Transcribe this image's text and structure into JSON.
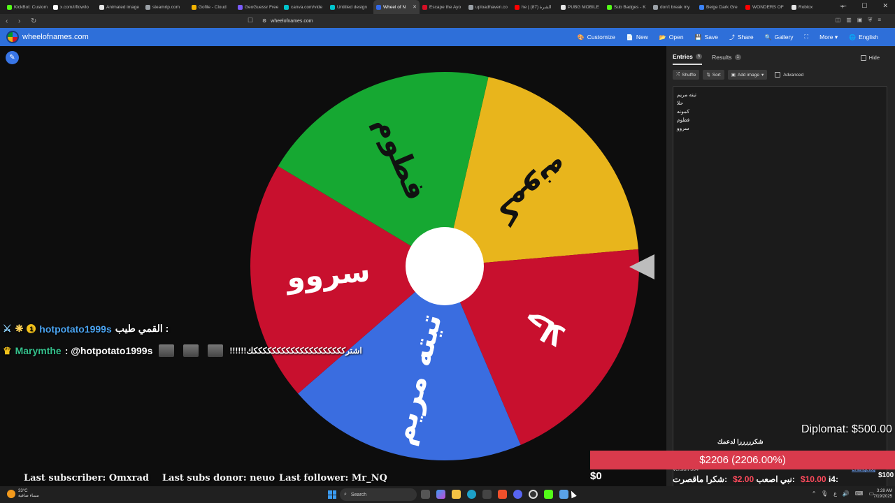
{
  "browser": {
    "tabs": [
      {
        "label": "KickBot: Custom",
        "color": "#53fc18"
      },
      {
        "label": "x.com/i/flow/lo",
        "color": "#ffffff"
      },
      {
        "label": "Animated image",
        "color": "#e5e5e5"
      },
      {
        "label": "steamrip.com",
        "color": "#9aa0a6"
      },
      {
        "label": "Gofile - Cloud",
        "color": "#f4b400"
      },
      {
        "label": "GeoGuessr Free",
        "color": "#7b5cff"
      },
      {
        "label": "canva.com/vide",
        "color": "#00c4cc"
      },
      {
        "label": "Untitled design",
        "color": "#00c4cc"
      },
      {
        "label": "Wheel of N",
        "color": "#3369e8",
        "active": true
      },
      {
        "label": "Escape the Ayo",
        "color": "#d50f25"
      },
      {
        "label": "uploadhaven.co",
        "color": "#9aa0a6"
      },
      {
        "label": "he | الشرة (87)",
        "color": "#ff0000"
      },
      {
        "label": "PUBG MOBILE",
        "color": "#e5e5e5"
      },
      {
        "label": "Sub Badges - K",
        "color": "#53fc18"
      },
      {
        "label": "don't break my",
        "color": "#9aa0a6"
      },
      {
        "label": "Beige Dark Gre",
        "color": "#3b82f6"
      },
      {
        "label": "WONDERS OF",
        "color": "#ff0000"
      },
      {
        "label": "Roblox",
        "color": "#e5e5e5"
      }
    ],
    "url": "wheelofnames.com"
  },
  "header": {
    "site_name": "wheelofnames.com",
    "menu": [
      {
        "label": "Customize",
        "icon": "palette-icon",
        "glyph": "🎨"
      },
      {
        "label": "New",
        "icon": "new-file-icon",
        "glyph": "📄"
      },
      {
        "label": "Open",
        "icon": "folder-icon",
        "glyph": "📂"
      },
      {
        "label": "Save",
        "icon": "save-icon",
        "glyph": "💾"
      },
      {
        "label": "Share",
        "icon": "share-icon",
        "glyph": "⤴"
      },
      {
        "label": "Gallery",
        "icon": "search-icon",
        "glyph": "🔍"
      },
      {
        "label": "",
        "icon": "fullscreen-icon",
        "glyph": "⛶"
      },
      {
        "label": "More ▾",
        "icon": "",
        "glyph": ""
      },
      {
        "label": "English",
        "icon": "globe-icon",
        "glyph": "🌐"
      }
    ]
  },
  "wheel": {
    "segments": [
      {
        "label": "كمونه",
        "color": "#e8b51c",
        "text_color": "#111111"
      },
      {
        "label": "حلا",
        "color": "#c8102e",
        "text_color": "#ffffff"
      },
      {
        "label": "تيته مريم",
        "color": "#3a6de0",
        "text_color": "#ffffff"
      },
      {
        "label": "سروو",
        "color": "#c8102e",
        "text_color": "#ffffff"
      },
      {
        "label": "فطوم",
        "color": "#16a832",
        "text_color": "#111111"
      }
    ]
  },
  "panel": {
    "tab_entries": "Entries",
    "entries_count": "5",
    "tab_results": "Results",
    "results_count": "1",
    "hide_label": "Hide",
    "shuffle_label": "Shuffle",
    "sort_label": "Sort",
    "add_image_label": "Add image",
    "advanced_label": "Advanced",
    "entries": [
      "تيته مريم",
      "حلا",
      "كمونه",
      "فطوم",
      "سروو"
    ],
    "version": "Version 364",
    "changelog": "Changelog"
  },
  "overlay": {
    "chat": [
      {
        "user": "hotpotato1999s",
        "message": "القمي طيب :"
      },
      {
        "user": "Marymthe",
        "message": ": @hotpotato1999s",
        "tail": "!!!!!!اشترككككككككككككككككككككك"
      }
    ],
    "last_subscriber": "Last subscriber: Omxrad",
    "last_subs_donor": "Last subs donor: neuo",
    "last_follower": "Last follower: Mr_NQ",
    "diplomat": "Diplomat: $500.00",
    "thanks": "شكرررررا لدعمك",
    "goal": "$2206 (2206.00%)",
    "goal_start": "$0",
    "goal_end": "$100",
    "ticker": [
      {
        "text": "شكرا ماقصرت:",
        "amount": ""
      },
      {
        "text": "نبي اصعب:",
        "amount": "$2.00"
      },
      {
        "text": "i4:",
        "amount": "$10.00"
      }
    ]
  },
  "taskbar": {
    "temp": "33°C",
    "weather_desc": "مساء صافية",
    "search": "Search",
    "time": "3:28 AM",
    "date": "7/19/2025"
  }
}
